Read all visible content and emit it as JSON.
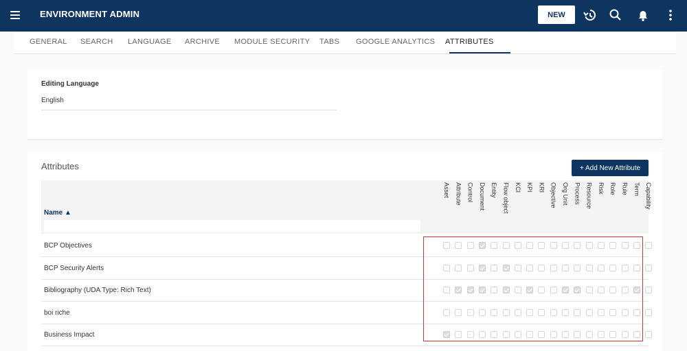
{
  "app": {
    "title": "ENVIRONMENT ADMIN",
    "new_label": "NEW"
  },
  "tabs": [
    {
      "label": "GENERAL",
      "active": false
    },
    {
      "label": "SEARCH",
      "active": false
    },
    {
      "label": "LANGUAGE",
      "active": false
    },
    {
      "label": "ARCHIVE",
      "active": false
    },
    {
      "label": "MODULE SECURITY",
      "active": false
    },
    {
      "label": "TABS",
      "active": false
    },
    {
      "label": "GOOGLE ANALYTICS",
      "active": false
    },
    {
      "label": "ATTRIBUTES",
      "active": true
    }
  ],
  "editing": {
    "label": "Editing Language",
    "value": "English"
  },
  "attributes": {
    "title": "Attributes",
    "add_label": "+ Add New Attribute",
    "name_header": "Name ▲",
    "columns": [
      "Asset",
      "Attribute",
      "Control",
      "Document",
      "Entity",
      "Flow object",
      "KCI",
      "KPI",
      "KRI",
      "Objective",
      "Org Unit",
      "Process",
      "Resource",
      "Risk",
      "Role",
      "Rule",
      "Term",
      "Capability"
    ],
    "rows": [
      {
        "name": "BCP Objectives",
        "checks": [
          0,
          0,
          0,
          1,
          0,
          0,
          0,
          0,
          0,
          0,
          0,
          0,
          0,
          0,
          0,
          0,
          0,
          0
        ]
      },
      {
        "name": "BCP Security Alerts",
        "checks": [
          0,
          0,
          0,
          1,
          0,
          1,
          0,
          0,
          0,
          0,
          0,
          0,
          0,
          0,
          0,
          0,
          0,
          0
        ]
      },
      {
        "name": "Bibliography (UDA Type: Rich Text)",
        "checks": [
          0,
          1,
          1,
          1,
          0,
          1,
          0,
          1,
          0,
          0,
          1,
          1,
          0,
          0,
          0,
          0,
          1,
          0
        ]
      },
      {
        "name": "boi riche",
        "checks": [
          0,
          0,
          0,
          0,
          0,
          0,
          0,
          0,
          0,
          0,
          0,
          0,
          0,
          0,
          0,
          0,
          0,
          0
        ]
      },
      {
        "name": "Business Impact",
        "checks": [
          1,
          0,
          0,
          0,
          0,
          0,
          0,
          0,
          0,
          0,
          0,
          0,
          0,
          0,
          0,
          0,
          0,
          0
        ]
      }
    ]
  },
  "colors": {
    "header_bg": "#0e3560",
    "highlight": "#d13535"
  }
}
